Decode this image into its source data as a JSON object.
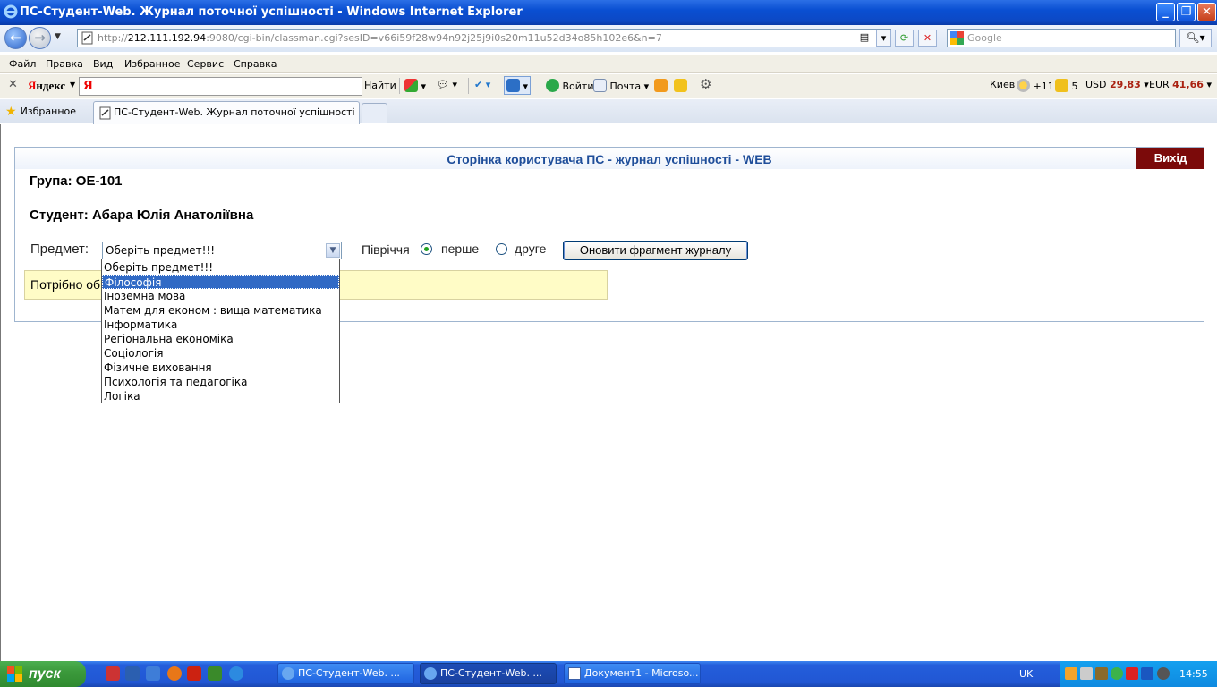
{
  "window": {
    "title": "ПС-Студент-Web. Журнал поточної успішності - Windows Internet Explorer",
    "minimize": "_",
    "maximize": "❐",
    "close": "✕"
  },
  "address_bar": {
    "url_prefix": "http://",
    "url_host": "212.111.192.94",
    "url_rest": ":9080/cgi-bin/classman.cgi?sesID=v66i59f28w94n92j25j9i0s20m11u52d34o85h102e6&n=7",
    "search_placeholder": "Google"
  },
  "menu": [
    "Файл",
    "Правка",
    "Вид",
    "Избранное",
    "Сервис",
    "Справка"
  ],
  "yandex_bar": {
    "logo_ya": "Я",
    "logo_rest": "ндекс",
    "input_letter": "Я",
    "find": "Найти",
    "login": "Войти",
    "mail": "Почта",
    "city": "Киев",
    "temperature": "+11",
    "traffic": "5",
    "usd_label": "USD",
    "usd_value": "29,83",
    "eur_label": "EUR",
    "eur_value": "41,66"
  },
  "tabs": {
    "favorites": "Избранное",
    "active_tab": "ПС-Студент-Web. Журнал поточної успішності"
  },
  "page": {
    "header_title": "Сторінка користувача ПС - журнал успішності - WEB",
    "logout": "Вихід",
    "group": "Група: ОЕ-101",
    "student": "Студент: Абара Юлія Анатоліївна",
    "subject_label": "Предмет:",
    "subject_selected": "Оберіть предмет!!!",
    "semester_label": "Півріччя",
    "semester_first": "перше",
    "semester_second": "друге",
    "semester_checked": "перше",
    "refresh_button": "Оновити фрагмент журналу",
    "notice": "Потрібно об"
  },
  "dropdown": {
    "highlighted_index": 1,
    "options": [
      "Оберіть предмет!!!",
      "Філософія",
      "Іноземна мова",
      "Матем для економ : вища математика",
      "Інформатика",
      "Регіональна економіка",
      "Соціологія",
      "Фізичне виховання",
      "Психологія та педагогіка",
      "Логіка"
    ]
  },
  "taskbar": {
    "start": "пуск",
    "tasks": [
      "ПС-Студент-Web. ...",
      "ПС-Студент-Web. ...",
      "Документ1 - Microso..."
    ],
    "active_task": 1,
    "language": "UK",
    "clock": "14:55"
  }
}
